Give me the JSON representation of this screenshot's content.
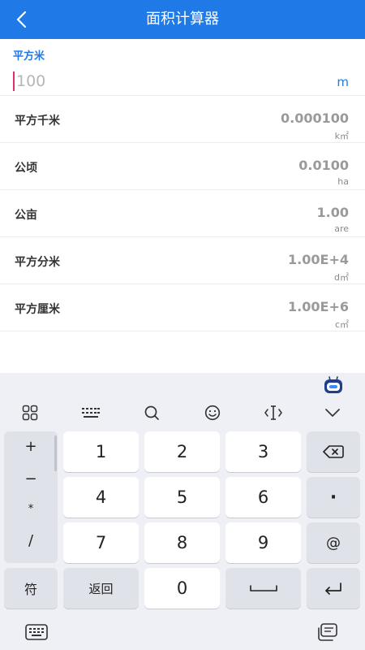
{
  "header": {
    "title": "面积计算器"
  },
  "input": {
    "label": "平方米",
    "placeholder": "100",
    "unit": "m"
  },
  "results": [
    {
      "name": "平方千米",
      "value": "0.000100",
      "unit": "k㎡"
    },
    {
      "name": "公顷",
      "value": "0.0100",
      "unit": "ha"
    },
    {
      "name": "公亩",
      "value": "1.00",
      "unit": "are"
    },
    {
      "name": "平方分米",
      "value": "1.00E+4",
      "unit": "d㎡"
    },
    {
      "name": "平方厘米",
      "value": "1.00E+6",
      "unit": "c㎡"
    }
  ],
  "keyboard": {
    "symbols": [
      "+",
      "−",
      "*",
      "/"
    ],
    "digits": [
      "1",
      "2",
      "3",
      "4",
      "5",
      "6",
      "7",
      "8",
      "9",
      "0"
    ],
    "dot": "·",
    "at": "@",
    "symbol_key": "符",
    "return_key": "返回"
  },
  "colors": {
    "primary": "#1f7ae8",
    "caret": "#e0306a",
    "keyboard_bg": "#eef0f5"
  },
  "icons": [
    "chevron-left-icon",
    "grid-icon",
    "keyboard-icon",
    "search-icon",
    "emoji-icon",
    "cursor-icon",
    "chevron-down-icon",
    "backspace-icon",
    "space-icon",
    "enter-icon",
    "clipboard-icon",
    "bot-icon"
  ]
}
